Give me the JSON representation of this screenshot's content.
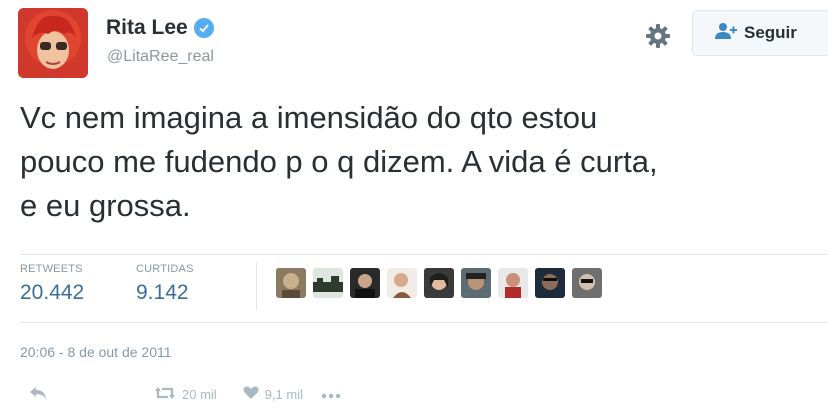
{
  "user": {
    "name": "Rita Lee",
    "handle": "@LitaRee_real"
  },
  "follow_label": "Seguir",
  "tweet": {
    "line1": "Vc nem imagina a imensidão do qto estou",
    "line2": "pouco me fudendo p o q dizem. A vida é curta,",
    "line3": "e eu grossa."
  },
  "stats": {
    "retweets_label": "RETWEETS",
    "retweets_value": "20.442",
    "likes_label": "CURTIDAS",
    "likes_value": "9.142"
  },
  "timestamp": "20:06 - 8 de out de 2011",
  "actions": {
    "retweet_count": "20 mil",
    "like_count": "9,1 mil"
  },
  "colors": {
    "accent": "#55acee",
    "stat_value": "#3b6f9b",
    "muted": "#8899a6"
  }
}
